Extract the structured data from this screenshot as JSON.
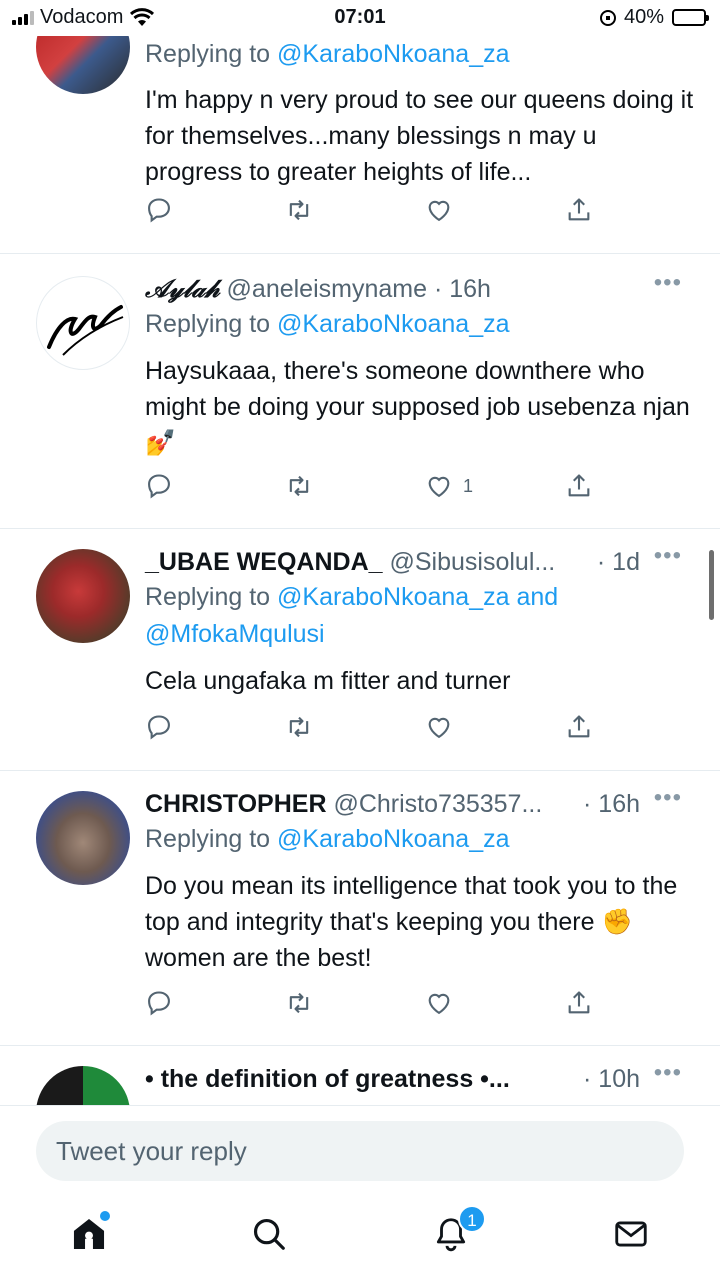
{
  "status_bar": {
    "carrier": "Vodacom",
    "time": "07:01",
    "battery": "40%",
    "battery_level": 0.4
  },
  "tweets": [
    {
      "name": "",
      "handle": "",
      "time": "",
      "reply_label": "Replying to",
      "mentions": "@KaraboNkoana_za",
      "body": "I'm happy n very proud to see our queens doing it for themselves...many blessings n may u progress to greater heights of life...",
      "likes": ""
    },
    {
      "name": "𝒜𝓎𝓁𝒶𝒽",
      "handle": "@aneleismyname",
      "time": "· 16h",
      "reply_label": "Replying to",
      "mentions": "@KaraboNkoana_za",
      "body": "Haysukaaa, there's someone downthere who might be doing your supposed job usebenza njan 💅",
      "likes": "1"
    },
    {
      "name": "_UBAE WEQANDA_",
      "handle": "@Sibusisolul...",
      "time": "· 1d",
      "reply_label": "Replying to",
      "mentions": "@KaraboNkoana_za and @MfokaMqulusi",
      "body": "Cela ungafaka m fitter and turner",
      "likes": ""
    },
    {
      "name": "CHRISTOPHER",
      "handle": "@Christo735357...",
      "time": "· 16h",
      "reply_label": "Replying to",
      "mentions": "@KaraboNkoana_za",
      "body": "Do you mean its intelligence that took you to the top and integrity that's keeping you there ✊ women are the best!",
      "likes": ""
    },
    {
      "name": "• the definition of greatness •...",
      "handle": "",
      "time": "· 10h",
      "reply_label": "",
      "mentions": "",
      "body": "",
      "likes": ""
    }
  ],
  "reply_box": {
    "placeholder": "Tweet your reply"
  },
  "tab_bar": {
    "notifications_badge": "1"
  },
  "more_glyph": "•••",
  "colors": {
    "accent": "#1d9bf0",
    "secondary_text": "#536471"
  }
}
